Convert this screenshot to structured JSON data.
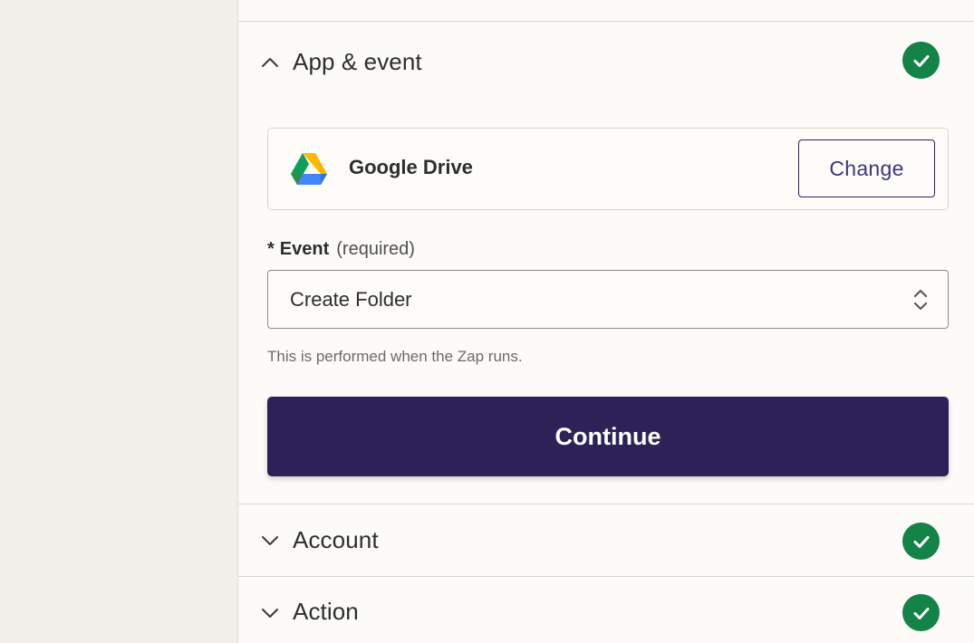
{
  "sections": {
    "app_event": {
      "title": "App & event",
      "expanded": true,
      "complete": true
    },
    "account": {
      "title": "Account",
      "expanded": false,
      "complete": true
    },
    "action": {
      "title": "Action",
      "expanded": false,
      "complete": true
    }
  },
  "app": {
    "name": "Google Drive",
    "icon": "google-drive-icon",
    "change_label": "Change"
  },
  "event_field": {
    "required_mark": "*",
    "label": "Event",
    "hint": "(required)",
    "value": "Create Folder",
    "help_text": "This is performed when the Zap runs."
  },
  "continue_label": "Continue",
  "colors": {
    "accent_dark": "#2c2258",
    "success_green": "#138347",
    "change_text": "#3a3680"
  }
}
